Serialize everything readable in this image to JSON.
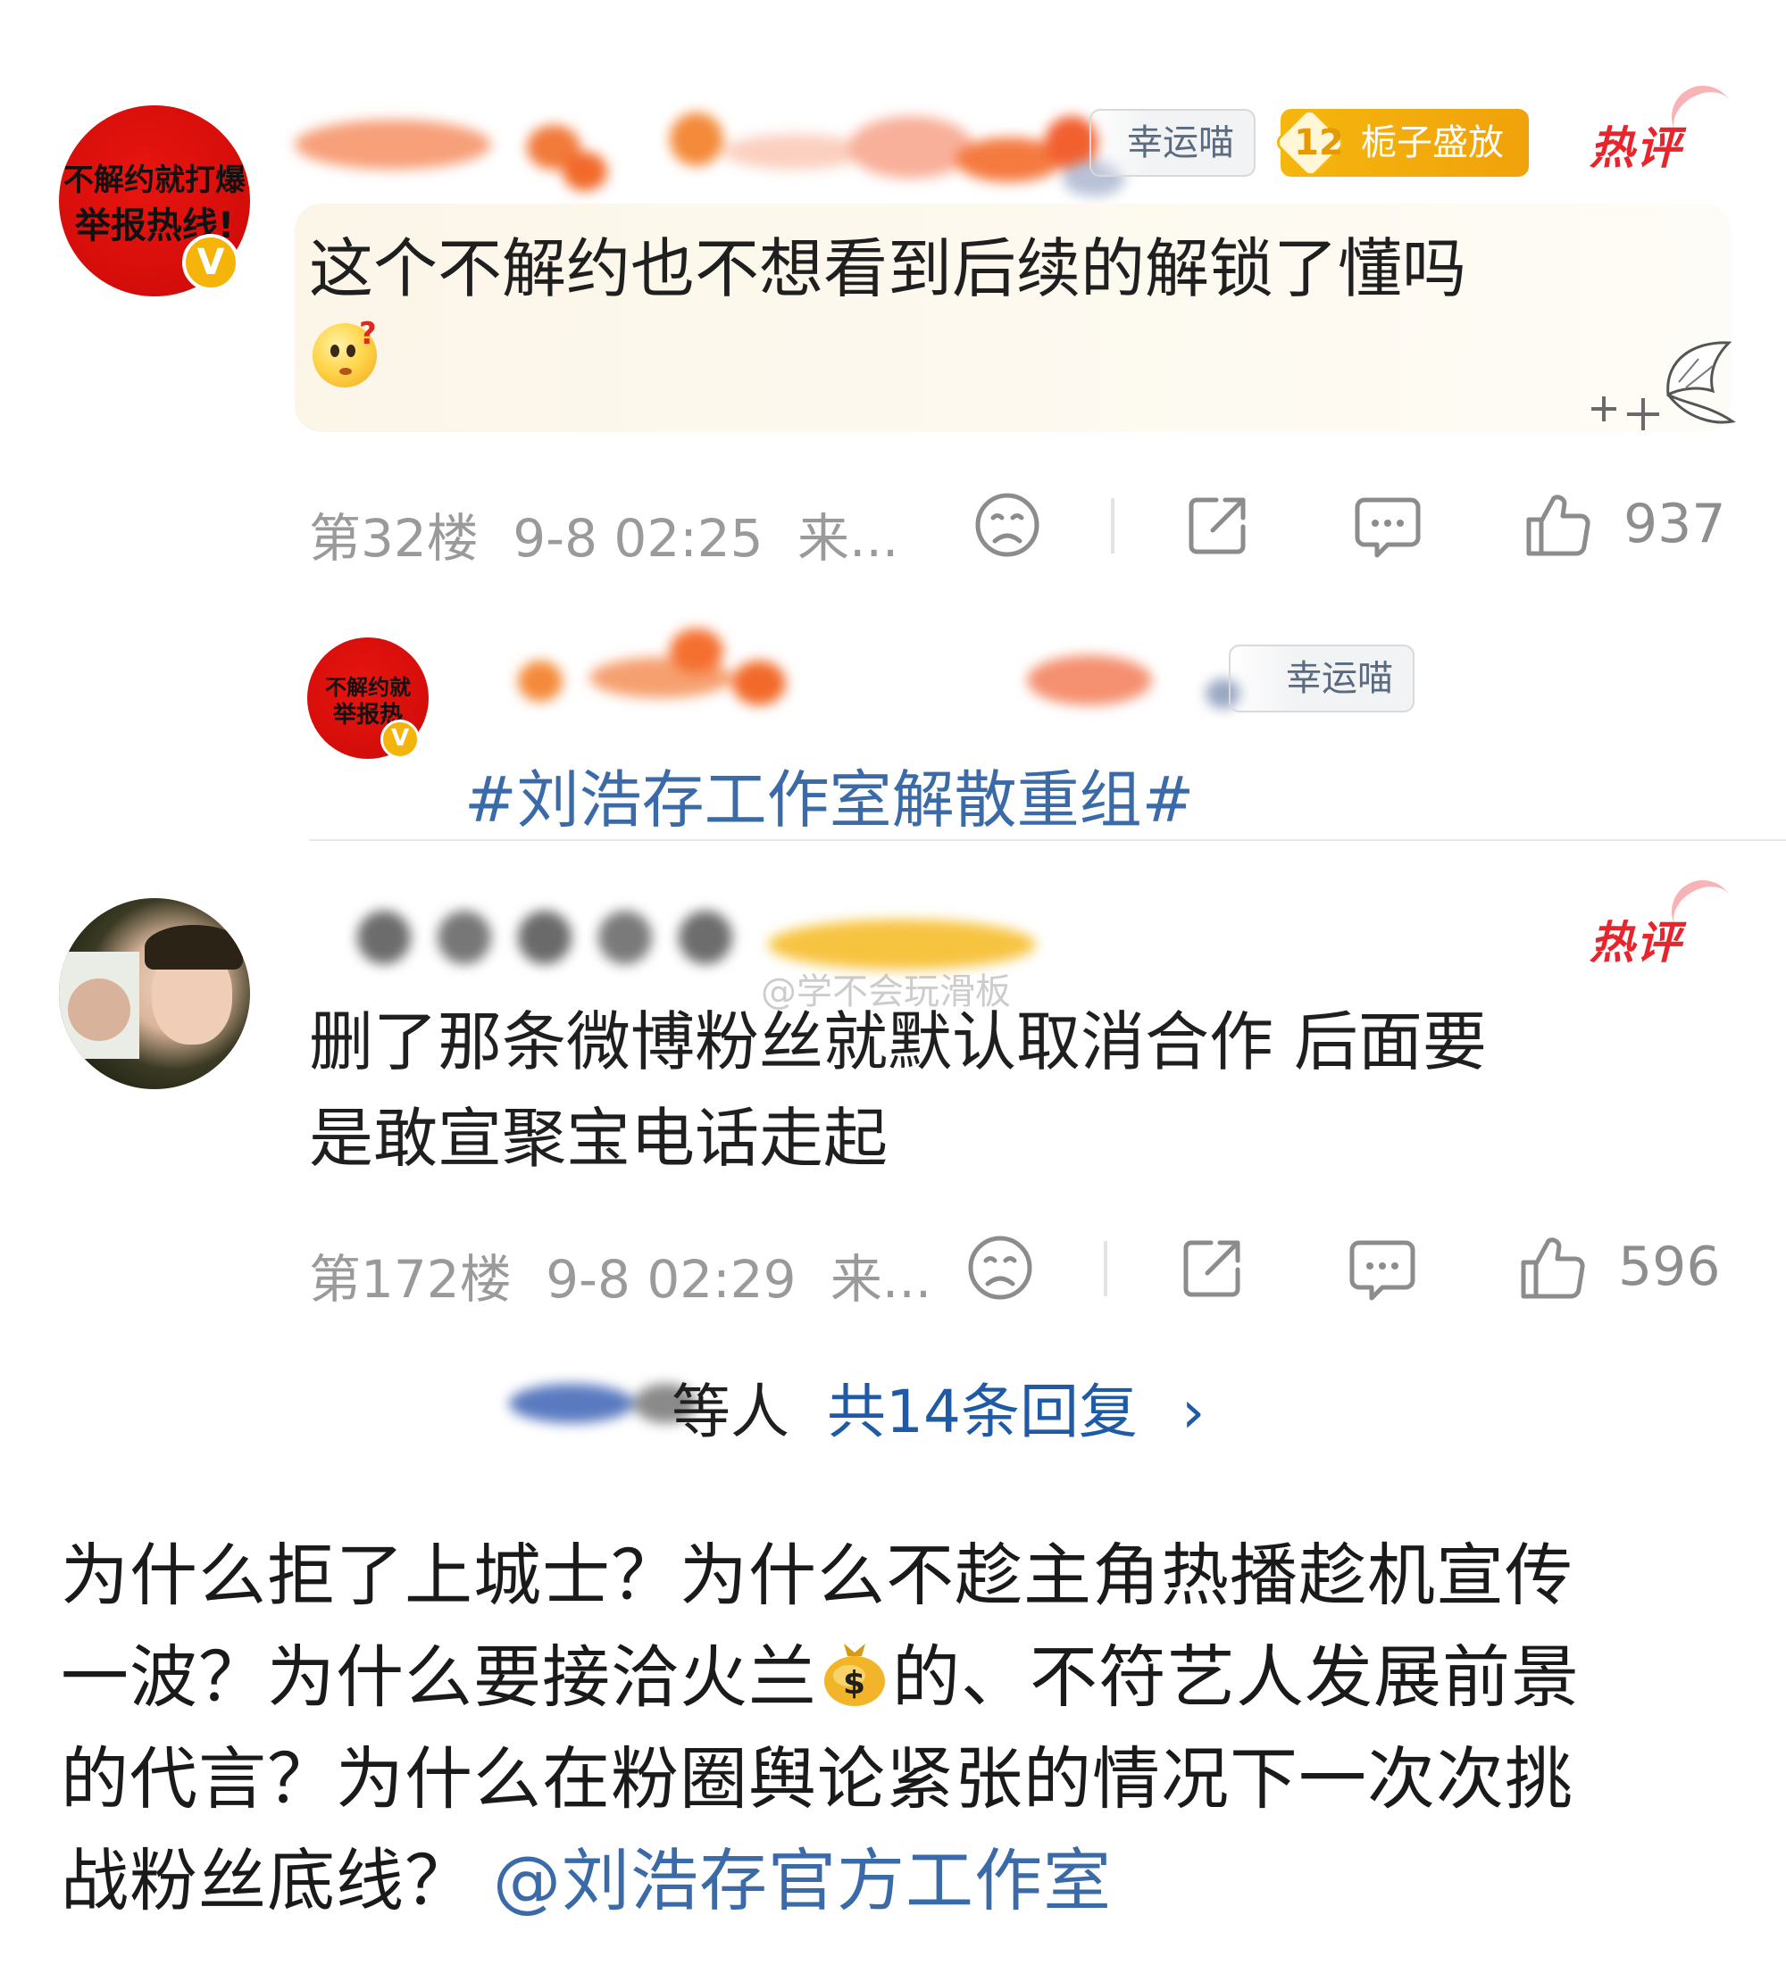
{
  "comments": [
    {
      "avatar_text": [
        "不解约就打爆",
        "举报热线!"
      ],
      "verified_badge": "V",
      "tags": [
        {
          "type": "lucky",
          "label": "幸运喵"
        },
        {
          "type": "fan_level",
          "level": "12",
          "label": "栀子盛放"
        }
      ],
      "hot_label": "热评",
      "text_lines": [
        "这个不解约也不想看到后续的解锁了懂吗"
      ],
      "emoji": "confused-face",
      "floor": "第32楼",
      "time": "9-8 02:25",
      "source": "来...",
      "likes": "937"
    },
    {
      "hot_label": "热评",
      "text_lines": [
        "删了那条微博粉丝就默认取消合作 后面要",
        "是敢宣聚宝电话走起"
      ],
      "floor": "第172楼",
      "time": "9-8 02:29",
      "source": "来...",
      "likes": "596"
    }
  ],
  "reply_preview": {
    "avatar_text": [
      "不解约就",
      "举报热"
    ],
    "verified_badge": "V",
    "tag_label": "幸运喵",
    "topic": "#刘浩存工作室解散重组#"
  },
  "reply_summary": {
    "tail": "等人",
    "count_label": "共14条回复",
    "chevron": "›"
  },
  "watermark": "@学不会玩滑板",
  "post": {
    "lines": [
      "为什么拒了上城士？为什么不趁主角热播趁机宣传",
      "一波？为什么要接洽火兰",
      "的、不符艺人发展前景",
      "的代言？为什么在粉圈舆论紧张的情况下一次次挑",
      "战粉丝底线？"
    ],
    "mention": "@刘浩存官方工作室",
    "money_emoji": "money-bag"
  },
  "colors": {
    "hot_red": "#e8242c",
    "link_blue": "#3b6aa8",
    "meta_gray": "#9a9a9a",
    "gold": "#f5b60e",
    "bubble": "#fbf6e8"
  }
}
